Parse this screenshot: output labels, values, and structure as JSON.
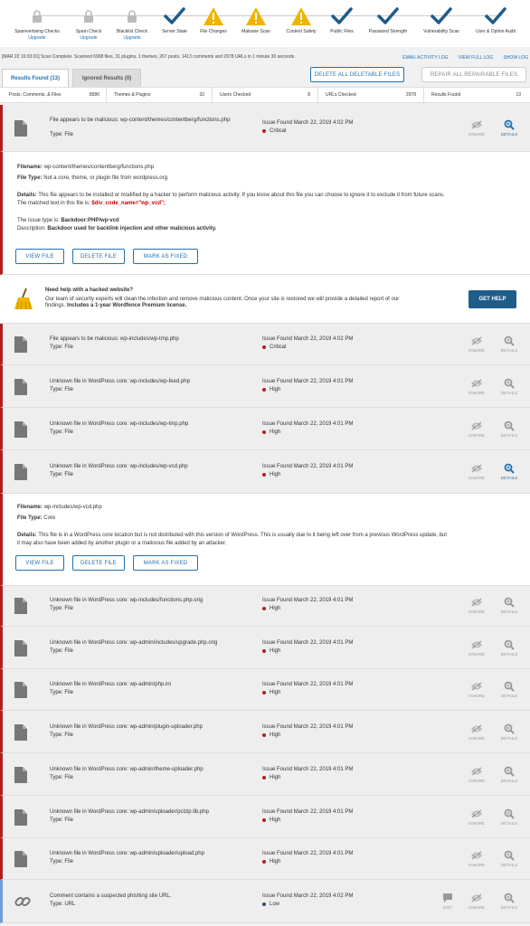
{
  "steps": [
    {
      "label": "Spamvertising Checks",
      "sub": "Upgrade",
      "state": "locked"
    },
    {
      "label": "Spam Check",
      "sub": "Upgrade",
      "state": "locked"
    },
    {
      "label": "Blacklist Check",
      "sub": "Upgrade",
      "state": "locked"
    },
    {
      "label": "Server State",
      "sub": "",
      "state": "ok"
    },
    {
      "label": "File Changes",
      "sub": "",
      "state": "warn"
    },
    {
      "label": "Malware Scan",
      "sub": "",
      "state": "warn"
    },
    {
      "label": "Content Safety",
      "sub": "",
      "state": "warn"
    },
    {
      "label": "Public Files",
      "sub": "",
      "state": "ok"
    },
    {
      "label": "Password Strength",
      "sub": "",
      "state": "ok"
    },
    {
      "label": "Vulnerability Scan",
      "sub": "",
      "state": "ok"
    },
    {
      "label": "User & Option Audit",
      "sub": "",
      "state": "ok"
    }
  ],
  "status_line": "[MAR 22 16:03:01] Scan Complete. Scanned 6908 files, 31 plugins, 1 themes, 267 posts, 1413 comments and 2978 URLs in 1 minute 30 seconds.",
  "links": {
    "email": "EMAIL ACTIVITY LOG",
    "full": "VIEW FULL LOG",
    "show": "SHOW LOG"
  },
  "tabs": {
    "found": "Results Found (13)",
    "ignored": "Ignored Results (0)"
  },
  "buttons": {
    "delete_all": "DELETE ALL DELETABLE FILES",
    "repair_all": "REPAIR ALL REPAIRABLE FILES",
    "view_file": "VIEW FILE",
    "delete_file": "DELETE FILE",
    "mark_fixed": "MARK AS FIXED",
    "get_help": "GET HELP"
  },
  "stats": [
    {
      "label": "Posts, Comments, & Files",
      "value": "8586"
    },
    {
      "label": "Themes & Plugins",
      "value": "32"
    },
    {
      "label": "Users Checked",
      "value": "8"
    },
    {
      "label": "URLs Checked",
      "value": "2978"
    },
    {
      "label": "Results Found",
      "value": "13"
    }
  ],
  "actions": {
    "ignore": "IGNORE",
    "details": "DETAILS",
    "edit": "EDIT"
  },
  "issues": [
    {
      "title": "File appears to be malicious: wp-content/themes/contentberg/functions.php",
      "type": "Type: File",
      "found": "Issue Found March 22, 2019 4:02 PM",
      "severity": "Critical",
      "sev_color": "#b01e1e"
    },
    {
      "title": "File appears to be malicious: wp-includes/wp-tmp.php",
      "type": "Type: File",
      "found": "Issue Found March 22, 2019 4:02 PM",
      "severity": "Critical",
      "sev_color": "#b01e1e"
    },
    {
      "title": "Unknown file in WordPress core: wp-includes/wp-feed.php",
      "type": "Type: File",
      "found": "Issue Found March 22, 2019 4:01 PM",
      "severity": "High",
      "sev_color": "#b01e1e"
    },
    {
      "title": "Unknown file in WordPress core: wp-includes/wp-tmp.php",
      "type": "Type: File",
      "found": "Issue Found March 22, 2019 4:01 PM",
      "severity": "High",
      "sev_color": "#b01e1e"
    },
    {
      "title": "Unknown file in WordPress core: wp-includes/wp-vcd.php",
      "type": "Type: File",
      "found": "Issue Found March 22, 2019 4:01 PM",
      "severity": "High",
      "sev_color": "#b01e1e"
    },
    {
      "title": "Unknown file in WordPress core: wp-includes/functions.php.orig",
      "type": "Type: File",
      "found": "Issue Found March 22, 2019 4:01 PM",
      "severity": "High",
      "sev_color": "#b01e1e"
    },
    {
      "title": "Unknown file in WordPress core: wp-admin/includes/upgrade.php.orig",
      "type": "Type: File",
      "found": "Issue Found March 22, 2019 4:01 PM",
      "severity": "High",
      "sev_color": "#b01e1e"
    },
    {
      "title": "Unknown file in WordPress core: wp-admin/php.ini",
      "type": "Type: File",
      "found": "Issue Found March 22, 2019 4:01 PM",
      "severity": "High",
      "sev_color": "#b01e1e"
    },
    {
      "title": "Unknown file in WordPress core: wp-admin/plugin-uploader.php",
      "type": "Type: File",
      "found": "Issue Found March 22, 2019 4:01 PM",
      "severity": "High",
      "sev_color": "#b01e1e"
    },
    {
      "title": "Unknown file in WordPress core: wp-admin/theme-uploader.php",
      "type": "Type: File",
      "found": "Issue Found March 22, 2019 4:01 PM",
      "severity": "High",
      "sev_color": "#b01e1e"
    },
    {
      "title": "Unknown file in WordPress core: wp-admin/uploader/pclzip.lib.php",
      "type": "Type: File",
      "found": "Issue Found March 22, 2019 4:01 PM",
      "severity": "High",
      "sev_color": "#b01e1e"
    },
    {
      "title": "Unknown file in WordPress core: wp-admin/uploader/upload.php",
      "type": "Type: File",
      "found": "Issue Found March 22, 2019 4:01 PM",
      "severity": "High",
      "sev_color": "#b01e1e"
    },
    {
      "title": "Comment contains a suspected phishing site URL.",
      "type": "Type: URL",
      "found": "Issue Found March 22, 2019 4:02 PM",
      "severity": "Low",
      "sev_color": "#2c4f6e"
    }
  ],
  "detail1": {
    "filename_label": "Filename:",
    "filename": "wp-content/themes/contentberg/functions.php",
    "filetype_label": "File Type:",
    "filetype": "Not a core, theme, or plugin file from wordpress.org.",
    "details_label": "Details:",
    "details": "This file appears to be installed or modified by a hacker to perform malicious activity. If you know about this file you can choose to ignore it to exclude it from future scans.",
    "matched": "The matched text in this file is:",
    "matched_code": "$div_code_name=\"wp_vcd\";",
    "issue_type_label": "The issue type is:",
    "issue_type": "Backdoor:PHP/wp-vcd",
    "desc_label": "Description:",
    "desc": "Backdoor used for backlink injection and other malicious activity."
  },
  "help": {
    "title": "Need help with a hacked website?",
    "line1": "Our team of security experts will clean the infection and remove malicious content. Once your site is restored we will provide a detailed report of our",
    "line2a": "findings.",
    "line2b": "Includes a 1-year Wordfence Premium license."
  },
  "detail2": {
    "filename_label": "Filename:",
    "filename": "wp-includes/wp-vcd.php",
    "filetype_label": "File Type:",
    "filetype": "Core",
    "details_label": "Details:",
    "details": "This file is in a WordPress core location but is not distributed with this version of WordPress. This is usually due to it being left over from a previous WordPress update, but",
    "details2": "it may also have been added by another plugin or a malicious file added by an attacker."
  },
  "colors": {
    "accent": "#2271b1",
    "critical": "#b01e1e",
    "warning": "#f0b400",
    "ok": "#1e5c8a",
    "help_button": "#1e5c8a"
  }
}
